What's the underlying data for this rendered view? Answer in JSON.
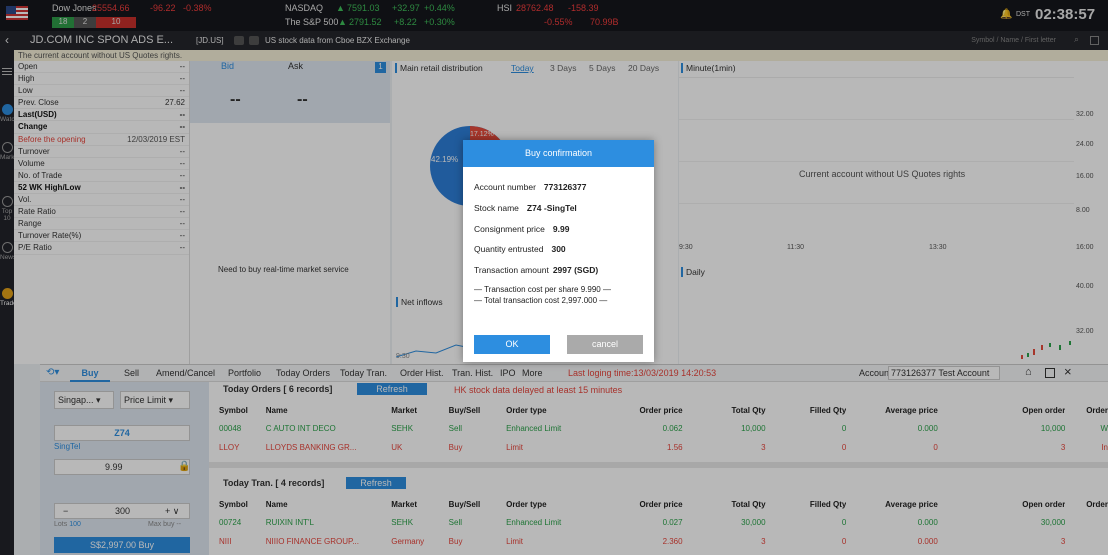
{
  "ticker": {
    "dj_name": "Dow Jones",
    "dj_value": "25554.66",
    "dj_change": "-96.22",
    "dj_pct": "-0.38%",
    "dj_up": "18",
    "dj_flat": "2",
    "dj_down": "10",
    "nasdaq_name": "NASDAQ",
    "nasdaq_value": "7591.03",
    "nasdaq_change": "+32.97",
    "nasdaq_pct": "+0.44%",
    "sp_name": "The S&P 500",
    "sp_value": "2791.52",
    "sp_change": "+8.22",
    "sp_pct": "+0.30%",
    "hsi_name": "HSI",
    "hsi_value": "28762.48",
    "hsi_change": "-158.39",
    "hsi_pct": "-0.55%",
    "hsi_vol": "70.99B",
    "dst": "DST",
    "time": "02:38:57"
  },
  "title": {
    "stock": "JD.COM INC SPON ADS E...",
    "code": "[JD.US]",
    "source": "US stock data from Cboe BZX Exchange",
    "search_placeholder": "Symbol / Name / First letter"
  },
  "notice": "The current account without US Quotes rights.",
  "nav": [
    "WatchList",
    "Markets",
    "Top 10",
    "News",
    "Trade"
  ],
  "quotes": [
    {
      "label": "Open",
      "value": "--"
    },
    {
      "label": "High",
      "value": "--"
    },
    {
      "label": "Low",
      "value": "--"
    },
    {
      "label": "Prev. Close",
      "value": "27.62"
    },
    {
      "label": "Last(USD)",
      "value": "--"
    },
    {
      "label": "Change",
      "value": "--"
    },
    {
      "label": "Before the opening",
      "value": "12/03/2019 EST"
    },
    {
      "label": "Turnover",
      "value": "--"
    },
    {
      "label": "Volume",
      "value": "--"
    },
    {
      "label": "No. of Trade",
      "value": "--"
    },
    {
      "label": "52 WK High/Low",
      "value": "--"
    },
    {
      "label": "Vol.",
      "value": "--"
    },
    {
      "label": "Rate Ratio",
      "value": "--"
    },
    {
      "label": "Range",
      "value": "--"
    },
    {
      "label": "Turnover Rate(%)",
      "value": "--"
    },
    {
      "label": "P/E Ratio",
      "value": "--"
    }
  ],
  "bidask": {
    "bid": "Bid",
    "ask": "Ask",
    "bid_val": "--",
    "ask_val": "--",
    "badge": "1",
    "msg": "Need to buy real-time market service"
  },
  "dist": {
    "title": "Main retail distribution",
    "tabs": [
      "Today",
      "3 Days",
      "5 Days",
      "20 Days"
    ],
    "pct_a": "42.19%",
    "pct_b": "17.12%",
    "inflow": "Net inflows",
    "x_time": "9:30"
  },
  "minute": {
    "title": "Minute(1min)",
    "msg": "Current account without US Quotes rights",
    "y": [
      "32.00",
      "24.00",
      "16.00",
      "8.00"
    ],
    "x": [
      "9:30",
      "11:30",
      "13:30",
      "16:00"
    ],
    "daily": "Daily",
    "dy": [
      "40.00",
      "32.00"
    ]
  },
  "modal": {
    "title": "Buy confirmation",
    "account_label": "Account number",
    "account": "773126377",
    "stock_label": "Stock name",
    "stock": "Z74 -SingTel",
    "price_label": "Consignment price",
    "price": "9.99",
    "qty_label": "Quantity entrusted",
    "qty": "300",
    "amount_label": "Transaction amount",
    "amount": "2997 (SGD)",
    "per_share": "Transaction cost per share 9.990",
    "total": "Total transaction cost 2,997.000",
    "ok": "OK",
    "cancel": "cancel"
  },
  "tradebar": {
    "buy": "Buy",
    "sell": "Sell",
    "amend": "Amend/Cancel",
    "tabs": [
      "Portfolio",
      "Today Orders",
      "Today Tran.",
      "Order Hist.",
      "Tran. Hist.",
      "IPO",
      "More"
    ],
    "last": "Last loging time:13/03/2019 14:20:53",
    "account": "Account",
    "account_val": "773126377 Test Account 77312("
  },
  "order": {
    "market": "Singap...",
    "type": "Price Limit",
    "symbol": "Z74",
    "name": "SingTel",
    "price": "9.99",
    "qty": "300",
    "lots_label": "Lots",
    "lots": "100",
    "maxbuy": "Max buy --",
    "submit": "S$2,997.00  Buy"
  },
  "today_orders": {
    "title": "Today Orders [ 6 records]",
    "refresh": "Refresh",
    "delay": "HK stock data delayed at least 15 minutes",
    "headers": [
      "Symbol",
      "Name",
      "Market",
      "Buy/Sell",
      "Order type",
      "Order price",
      "Total Qty",
      "Filled Qty",
      "Average price",
      "Open order",
      "Order"
    ],
    "rows": [
      [
        "00048",
        "C AUTO INT DECO",
        "SEHK",
        "Sell",
        "Enhanced Limit",
        "0.062",
        "10,000",
        "0",
        "0.000",
        "10,000",
        "W"
      ],
      [
        "LLOY",
        "LLOYDS BANKING GR...",
        "UK",
        "Buy",
        "Limit",
        "1.56",
        "3",
        "0",
        "0",
        "3",
        "In"
      ]
    ]
  },
  "today_tran": {
    "title": "Today Tran. [ 4 records]",
    "refresh": "Refresh",
    "headers": [
      "Symbol",
      "Name",
      "Market",
      "Buy/Sell",
      "Order type",
      "Order price",
      "Total Qty",
      "Filled Qty",
      "Average price",
      "Open order",
      "Order"
    ],
    "rows": [
      [
        "00724",
        "RUIXIN INT'L",
        "SEHK",
        "Sell",
        "Enhanced Limit",
        "0.027",
        "30,000",
        "0",
        "0.000",
        "30,000",
        ""
      ],
      [
        "NIII",
        "NIIIO FINANCE GROUP...",
        "Germany",
        "Buy",
        "Limit",
        "2.360",
        "3",
        "0",
        "0.000",
        "3",
        ""
      ]
    ]
  }
}
